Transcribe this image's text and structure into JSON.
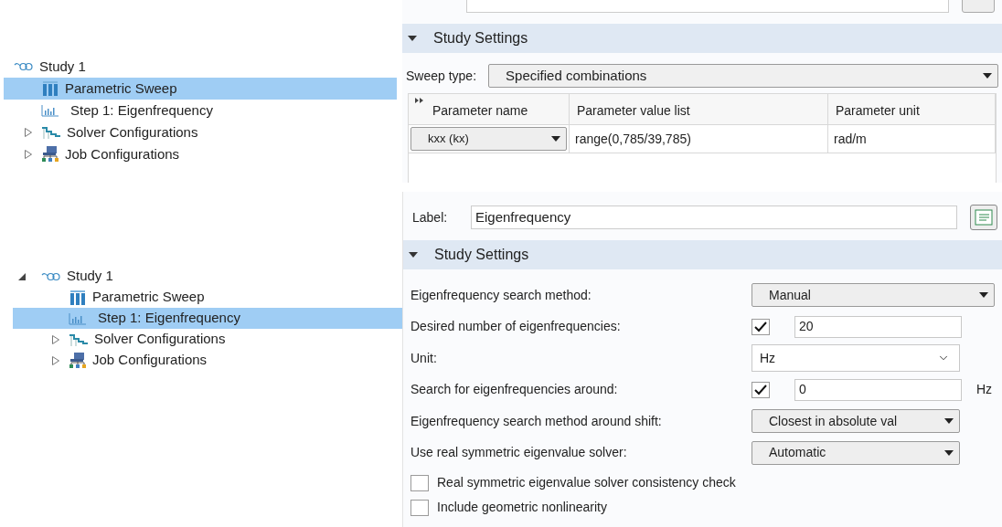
{
  "trees": [
    {
      "items": [
        {
          "label": "Study 1",
          "kind": "study",
          "selected": false,
          "children": [
            {
              "label": "Parametric Sweep",
              "kind": "sweep",
              "selected": true
            },
            {
              "label": "Step 1: Eigenfrequency",
              "kind": "step",
              "selected": false
            },
            {
              "label": "Solver Configurations",
              "kind": "solver",
              "selected": false,
              "expanded": false
            },
            {
              "label": "Job Configurations",
              "kind": "job",
              "selected": false,
              "expanded": false
            }
          ]
        }
      ]
    },
    {
      "items": [
        {
          "label": "Study 1",
          "kind": "study",
          "selected": false,
          "expanded": true,
          "children": [
            {
              "label": "Parametric Sweep",
              "kind": "sweep",
              "selected": false
            },
            {
              "label": "Step 1: Eigenfrequency",
              "kind": "step",
              "selected": true
            },
            {
              "label": "Solver Configurations",
              "kind": "solver",
              "selected": false,
              "expanded": false
            },
            {
              "label": "Job Configurations",
              "kind": "job",
              "selected": false,
              "expanded": false
            }
          ]
        }
      ]
    }
  ],
  "sweep_panel": {
    "section": {
      "title": "Study Settings",
      "expanded": true
    },
    "sweep_type": {
      "label": "Sweep type:",
      "value": "Specified combinations"
    },
    "table": {
      "columns": [
        "Parameter name",
        "Parameter value list",
        "Parameter unit"
      ],
      "rows": [
        [
          "kxx (kx)",
          "range(0,785/39,785)",
          "rad/m"
        ]
      ]
    }
  },
  "eigen_panel": {
    "label": {
      "label": "Label:",
      "value": "Eigenfrequency"
    },
    "section": {
      "title": "Study Settings",
      "expanded": true
    },
    "settings": [
      {
        "kind": "select_wide",
        "label": "Eigenfrequency search method:",
        "value": "Manual"
      },
      {
        "kind": "check_input",
        "label": "Desired number of eigenfrequencies:",
        "checked": true,
        "value": "20"
      },
      {
        "kind": "combo",
        "label": "Unit:",
        "value": "Hz"
      },
      {
        "kind": "check_input",
        "label": "Search for eigenfrequencies around:",
        "checked": true,
        "value": "0",
        "unit": "Hz"
      },
      {
        "kind": "select",
        "label": "Eigenfrequency search method around shift:",
        "value": "Closest in absolute val"
      },
      {
        "kind": "select",
        "label": "Use real symmetric eigenvalue solver:",
        "value": "Automatic"
      }
    ],
    "checkboxes": [
      {
        "label": "Real symmetric eigenvalue solver consistency check",
        "checked": false
      },
      {
        "label": "Include geometric nonlinearity",
        "checked": false
      }
    ]
  }
}
